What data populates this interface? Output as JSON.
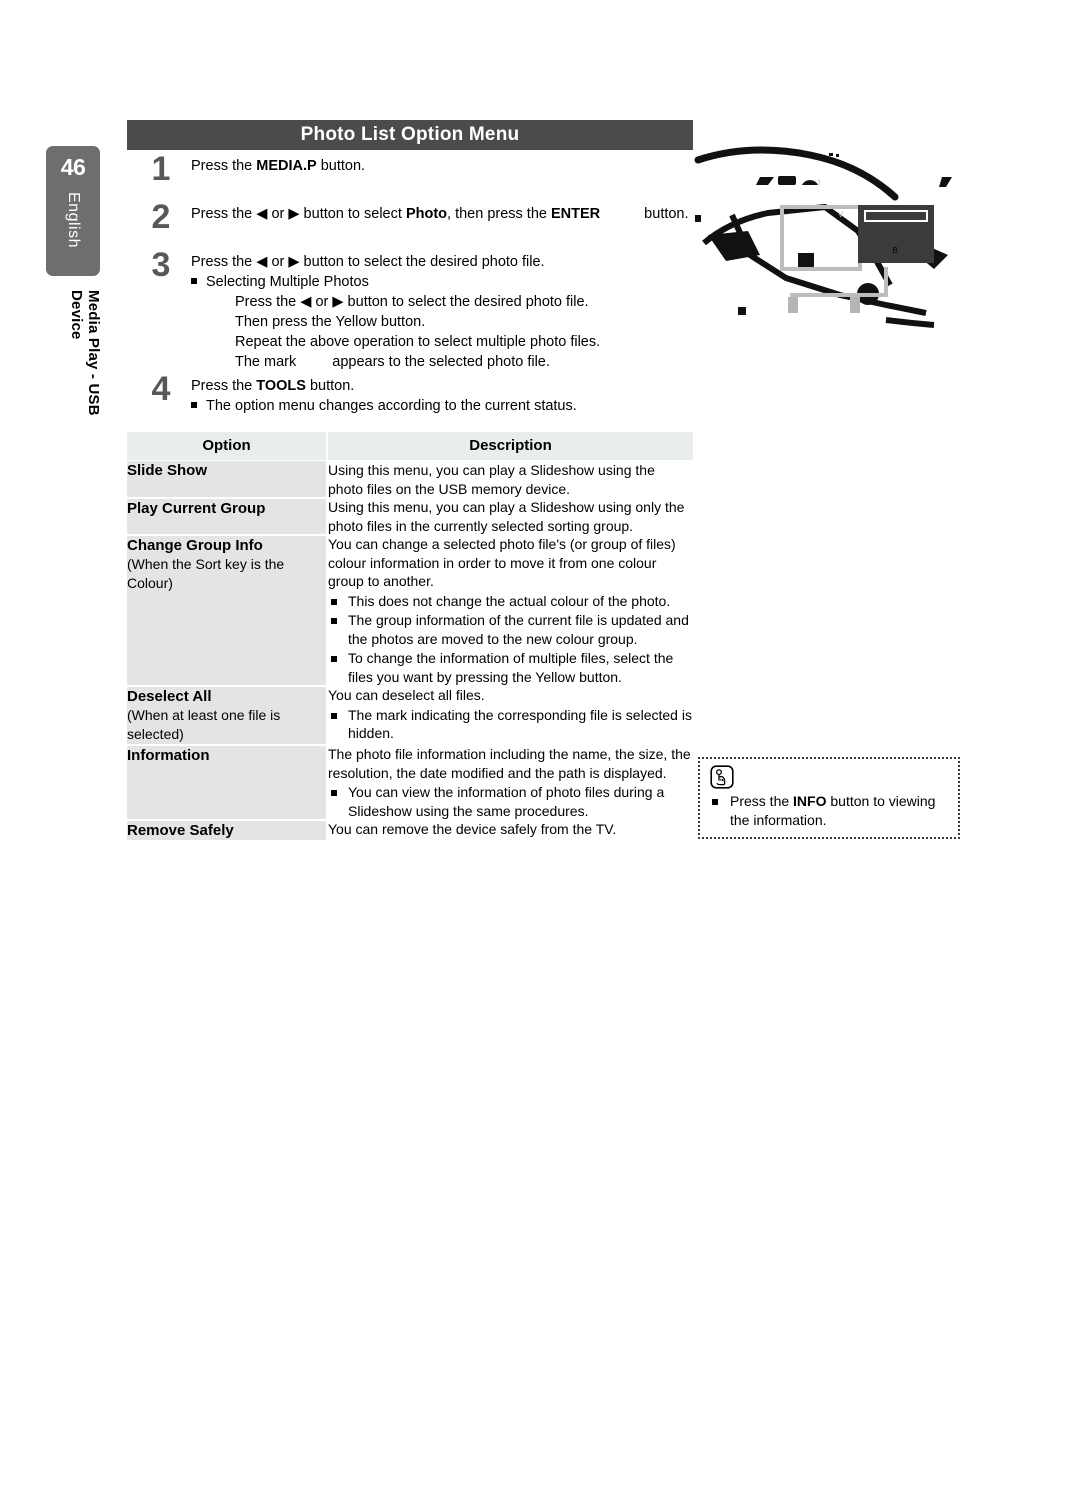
{
  "page": {
    "number": "46",
    "language": "English",
    "chapter": "Media Play - USB Device",
    "header_title": "Photo List Option Menu",
    "header_bg": "#4b4b4b",
    "side_tab_bg": "#6e6e6e"
  },
  "steps": [
    {
      "num": "1",
      "lines": [
        {
          "parts": [
            {
              "t": "Press the "
            },
            {
              "t": "MEDIA.P",
              "b": true
            },
            {
              "t": " button."
            }
          ]
        }
      ]
    },
    {
      "num": "2",
      "lines": [
        {
          "parts": [
            {
              "t": "Press the ◀ or ▶ button to select "
            },
            {
              "t": "Photo",
              "b": true
            },
            {
              "t": ", then press the "
            },
            {
              "t": "ENTER",
              "b": true
            },
            {
              "t": "",
              "gap": "wide"
            },
            {
              "t": " button."
            }
          ]
        }
      ]
    },
    {
      "num": "3",
      "lines": [
        {
          "parts": [
            {
              "t": "Press the ◀ or ▶ button to select the desired photo file."
            }
          ]
        },
        {
          "sq": true,
          "parts": [
            {
              "t": "Selecting Multiple Photos"
            }
          ]
        },
        {
          "indent": 2,
          "parts": [
            {
              "t": "Press the ◀ or ▶ button to select the desired photo file."
            }
          ]
        },
        {
          "indent": 2,
          "parts": [
            {
              "t": "Then press the Yellow button."
            }
          ]
        },
        {
          "indent": 2,
          "parts": [
            {
              "t": "Repeat the above operation to select multiple photo files."
            }
          ]
        },
        {
          "indent": 2,
          "parts": [
            {
              "t": "The mark"
            },
            {
              "t": "",
              "gap": "mid"
            },
            {
              "t": "appears to the selected photo file."
            }
          ]
        }
      ]
    },
    {
      "num": "4",
      "lines": [
        {
          "parts": [
            {
              "t": "Press the "
            },
            {
              "t": "TOOLS",
              "b": true
            },
            {
              "t": " button."
            }
          ]
        },
        {
          "sq": true,
          "parts": [
            {
              "t": "The option menu changes according to the current status."
            }
          ]
        }
      ]
    }
  ],
  "table": {
    "headers": {
      "option": "Option",
      "description": "Description"
    },
    "rows": [
      {
        "name": "Slide Show",
        "sub": "",
        "desc_paragraphs": [
          "Using this menu, you can play a Slideshow using the photo files on the USB memory device."
        ],
        "desc_bullets": []
      },
      {
        "name": "Play Current Group",
        "sub": "",
        "desc_paragraphs": [
          "Using this menu, you can play a Slideshow using only the photo files in the currently selected sorting group."
        ],
        "desc_bullets": []
      },
      {
        "name": "Change Group Info",
        "sub": "(When the Sort key is the Colour)",
        "desc_paragraphs": [
          "You can change a selected photo file's (or group of files) colour information in order to move it from one colour group to another."
        ],
        "desc_bullets": [
          "This does not change the actual colour of the photo.",
          "The group information of the current file is updated and the photos are moved to the new colour group.",
          "To change the information of multiple files, select the files you want by pressing the Yellow button."
        ]
      },
      {
        "name": "Deselect All",
        "sub": "(When at least one file is selected)",
        "desc_paragraphs": [
          "You can deselect all files."
        ],
        "desc_bullets": [
          "The      mark indicating the corresponding file is selected is hidden."
        ]
      },
      {
        "name": "Information",
        "sub": "",
        "desc_paragraphs": [
          "The photo file information including the name, the size, the resolution, the date modified and the path is displayed."
        ],
        "desc_bullets": [
          "You can view the information of photo files during a Slideshow using the same procedures."
        ]
      },
      {
        "name": "Remove Safely",
        "sub": "",
        "desc_paragraphs": [
          "You can remove the device safely from the TV."
        ],
        "desc_bullets": []
      }
    ]
  },
  "note": {
    "icon": "press-button-hand-icon",
    "text_before": "Press the ",
    "text_bold": "INFO",
    "text_after": " button to viewing the information."
  }
}
